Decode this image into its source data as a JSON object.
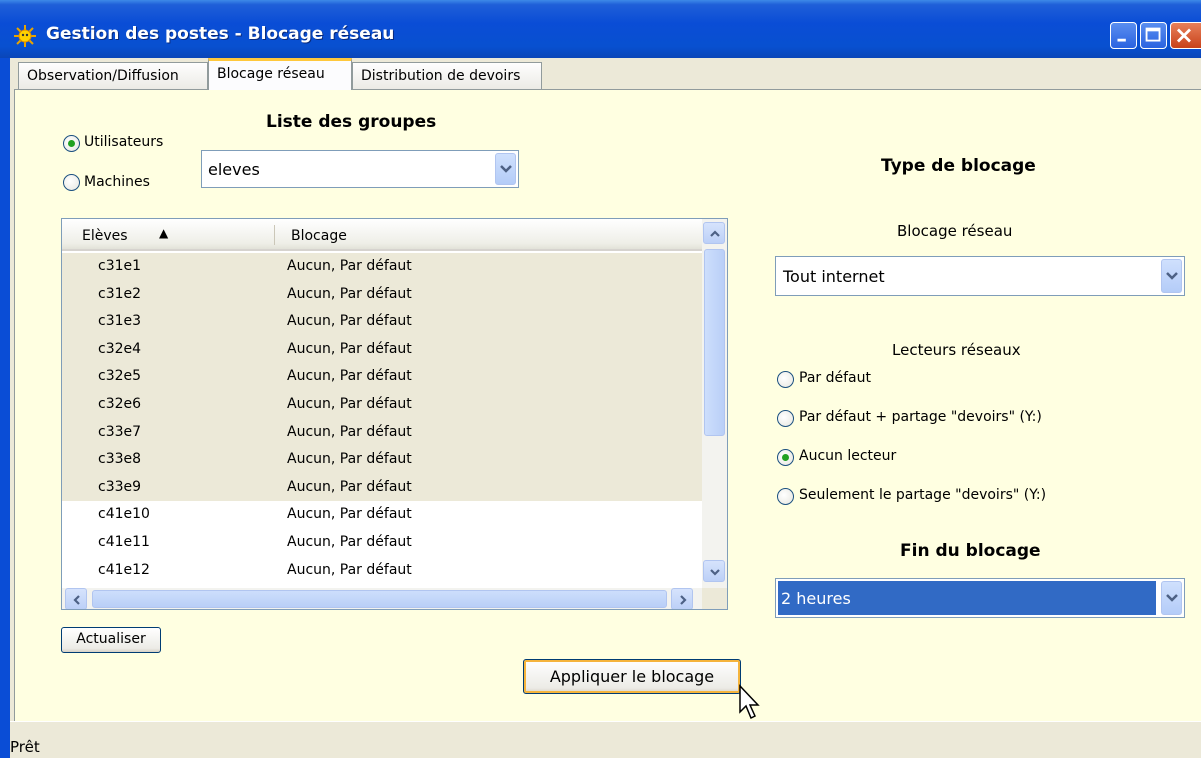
{
  "window": {
    "title": "Gestion des postes - Blocage réseau",
    "icon": "sun-icon"
  },
  "tabs": [
    {
      "label": "Observation/Diffusion",
      "active": false
    },
    {
      "label": "Blocage réseau",
      "active": true
    },
    {
      "label": "Distribution de devoirs",
      "active": false
    }
  ],
  "groups": {
    "heading": "Liste des groupes",
    "radio_users": "Utilisateurs",
    "radio_machines": "Machines",
    "selected_radio": "Utilisateurs",
    "combo_value": "eleves"
  },
  "list": {
    "col_name": "Elèves",
    "col_block": "Blocage",
    "sort_indicator": "▲",
    "rows": [
      {
        "name": "c31e1",
        "block": "Aucun, Par défaut",
        "selected": true
      },
      {
        "name": "c31e2",
        "block": "Aucun, Par défaut",
        "selected": true
      },
      {
        "name": "c31e3",
        "block": "Aucun, Par défaut",
        "selected": true
      },
      {
        "name": "c32e4",
        "block": "Aucun, Par défaut",
        "selected": true
      },
      {
        "name": "c32e5",
        "block": "Aucun, Par défaut",
        "selected": true
      },
      {
        "name": "c32e6",
        "block": "Aucun, Par défaut",
        "selected": true
      },
      {
        "name": "c33e7",
        "block": "Aucun, Par défaut",
        "selected": true
      },
      {
        "name": "c33e8",
        "block": "Aucun, Par défaut",
        "selected": true
      },
      {
        "name": "c33e9",
        "block": "Aucun, Par défaut",
        "selected": true
      },
      {
        "name": "c41e10",
        "block": "Aucun, Par défaut",
        "selected": false
      },
      {
        "name": "c41e11",
        "block": "Aucun, Par défaut",
        "selected": false
      },
      {
        "name": "c41e12",
        "block": "Aucun, Par défaut",
        "selected": false
      }
    ]
  },
  "refresh_button": "Actualiser",
  "apply_button": "Appliquer le blocage",
  "type": {
    "heading": "Type de blocage",
    "network_label": "Blocage réseau",
    "network_value": "Tout internet",
    "drives_label": "Lecteurs réseaux",
    "drive_options": [
      "Par défaut",
      "Par défaut + partage \"devoirs\" (Y:)",
      "Aucun lecteur",
      "Seulement le partage \"devoirs\" (Y:)"
    ],
    "drive_selected": 2,
    "end_label": "Fin du blocage",
    "end_value": "2 heures"
  },
  "status": {
    "text": "Prêt"
  },
  "colors": {
    "panel_bg": "#ffffe1",
    "titlebar": "#0a4dd6",
    "selection": "#316ac5",
    "tab_accent": "#ffc83c"
  }
}
